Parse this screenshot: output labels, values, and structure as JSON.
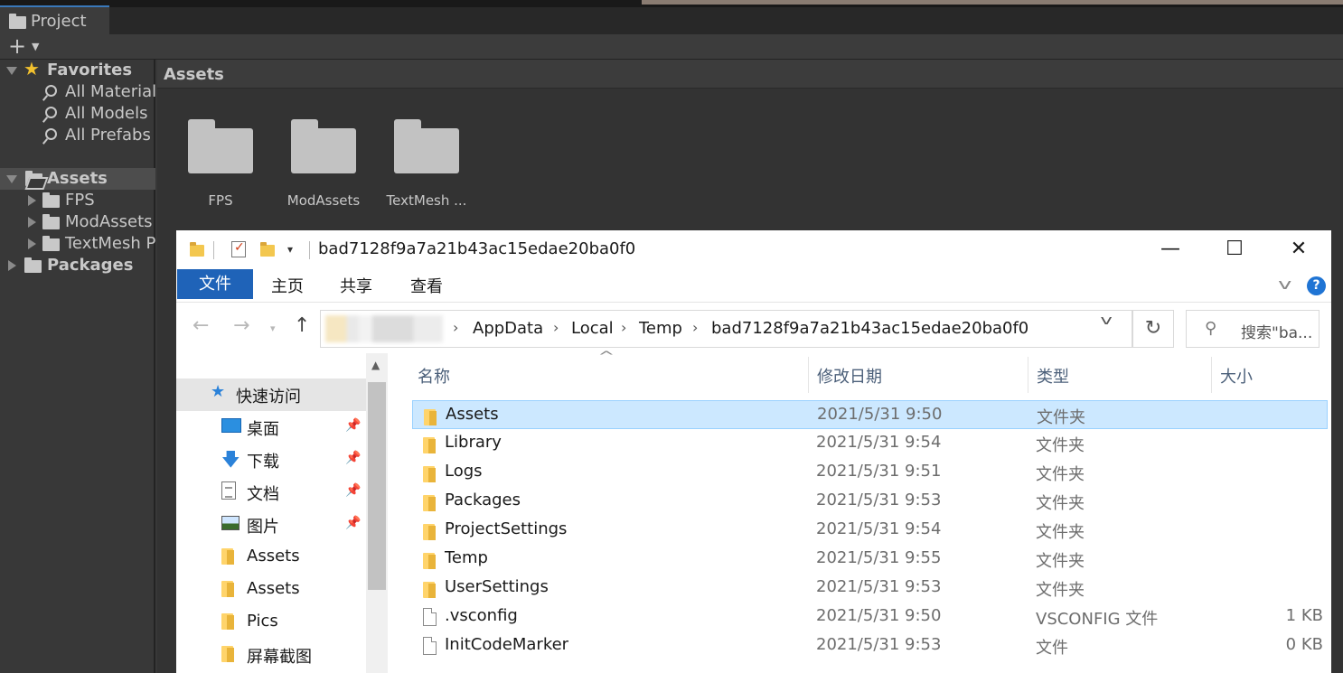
{
  "unity": {
    "tab_title": "Project",
    "breadcrumb": "Assets",
    "favorites": {
      "label": "Favorites",
      "items": [
        "All Material",
        "All Models",
        "All Prefabs"
      ]
    },
    "assets_tree": {
      "label": "Assets",
      "children": [
        "FPS",
        "ModAssets",
        "TextMesh P"
      ]
    },
    "packages_label": "Packages",
    "grid_items": [
      "FPS",
      "ModAssets",
      "TextMesh ..."
    ]
  },
  "explorer": {
    "title": "bad7128f9a7a21b43ac15edae20ba0f0",
    "window_controls": {
      "minimize": "—",
      "maximize": "☐",
      "close": "✕"
    },
    "ribbon_tabs": [
      "文件",
      "主页",
      "共享",
      "查看"
    ],
    "help_label": "?",
    "address": {
      "segments": [
        "AppData",
        "Local",
        "Temp",
        "bad7128f9a7a21b43ac15edae20ba0f0"
      ]
    },
    "search_placeholder": "搜索\"ba...",
    "sidebar": [
      {
        "label": "快速访问",
        "icon": "star-icon",
        "pinned": false
      },
      {
        "label": "桌面",
        "icon": "desktop-icon",
        "pinned": true
      },
      {
        "label": "下载",
        "icon": "download-icon",
        "pinned": true
      },
      {
        "label": "文档",
        "icon": "document-icon",
        "pinned": true
      },
      {
        "label": "图片",
        "icon": "pictures-icon",
        "pinned": true
      },
      {
        "label": "Assets",
        "icon": "folder-icon",
        "pinned": false
      },
      {
        "label": "Assets",
        "icon": "folder-icon",
        "pinned": false
      },
      {
        "label": "Pics",
        "icon": "folder-icon",
        "pinned": false
      },
      {
        "label": "屏幕截图",
        "icon": "folder-icon",
        "pinned": false
      }
    ],
    "columns": [
      "名称",
      "修改日期",
      "类型",
      "大小"
    ],
    "files": [
      {
        "name": "Assets",
        "date": "2021/5/31 9:50",
        "type": "文件夹",
        "size": "",
        "kind": "folder",
        "selected": true
      },
      {
        "name": "Library",
        "date": "2021/5/31 9:54",
        "type": "文件夹",
        "size": "",
        "kind": "folder"
      },
      {
        "name": "Logs",
        "date": "2021/5/31 9:51",
        "type": "文件夹",
        "size": "",
        "kind": "folder"
      },
      {
        "name": "Packages",
        "date": "2021/5/31 9:53",
        "type": "文件夹",
        "size": "",
        "kind": "folder"
      },
      {
        "name": "ProjectSettings",
        "date": "2021/5/31 9:54",
        "type": "文件夹",
        "size": "",
        "kind": "folder"
      },
      {
        "name": "Temp",
        "date": "2021/5/31 9:55",
        "type": "文件夹",
        "size": "",
        "kind": "folder"
      },
      {
        "name": "UserSettings",
        "date": "2021/5/31 9:53",
        "type": "文件夹",
        "size": "",
        "kind": "folder"
      },
      {
        "name": ".vsconfig",
        "date": "2021/5/31 9:50",
        "type": "VSCONFIG 文件",
        "size": "1 KB",
        "kind": "file"
      },
      {
        "name": "InitCodeMarker",
        "date": "2021/5/31 9:53",
        "type": "文件",
        "size": "0 KB",
        "kind": "file"
      }
    ]
  }
}
